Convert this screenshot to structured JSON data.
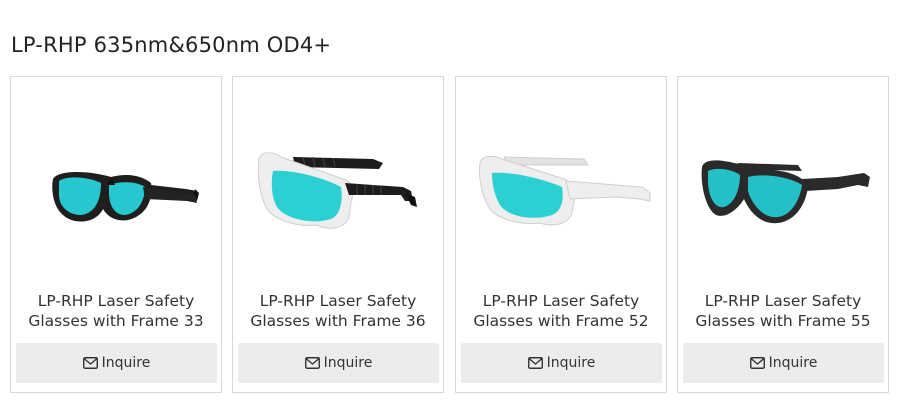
{
  "section": {
    "title": "LP-RHP 635nm&650nm OD4+"
  },
  "products": [
    {
      "name": "LP-RHP Laser Safety Glasses with Frame 33",
      "button_label": "Inquire",
      "frame_color": "#1e1e1e",
      "lens_color": "#26c7cf",
      "icon": "envelope-icon"
    },
    {
      "name": "LP-RHP Laser Safety Glasses with Frame 36",
      "button_label": "Inquire",
      "frame_color": "#ececec",
      "lens_color": "#2ccfd2",
      "icon": "envelope-icon"
    },
    {
      "name": "LP-RHP Laser Safety Glasses with Frame 52",
      "button_label": "Inquire",
      "frame_color": "#ececec",
      "lens_color": "#2ccfd2",
      "icon": "envelope-icon"
    },
    {
      "name": "LP-RHP Laser Safety Glasses with Frame 55",
      "button_label": "Inquire",
      "frame_color": "#2a2a2a",
      "lens_color": "#24c0c8",
      "icon": "envelope-icon"
    }
  ],
  "colors": {
    "button_bg": "#ececec",
    "card_border": "#d8d8d8",
    "text": "#333333"
  }
}
